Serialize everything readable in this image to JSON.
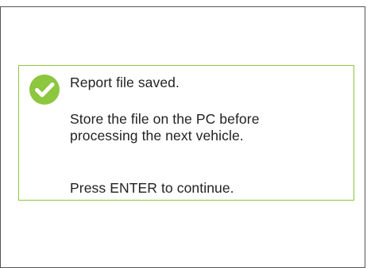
{
  "dialog": {
    "title": "Report file saved.",
    "body_line_1": "Store the file on the PC before",
    "body_line_2": "processing the next vehicle.",
    "prompt": "Press ENTER to continue.",
    "icon": "check-circle-icon"
  },
  "colors": {
    "accent": "#8dc63f",
    "border": "#555555",
    "text": "#222222",
    "background": "#ffffff"
  }
}
